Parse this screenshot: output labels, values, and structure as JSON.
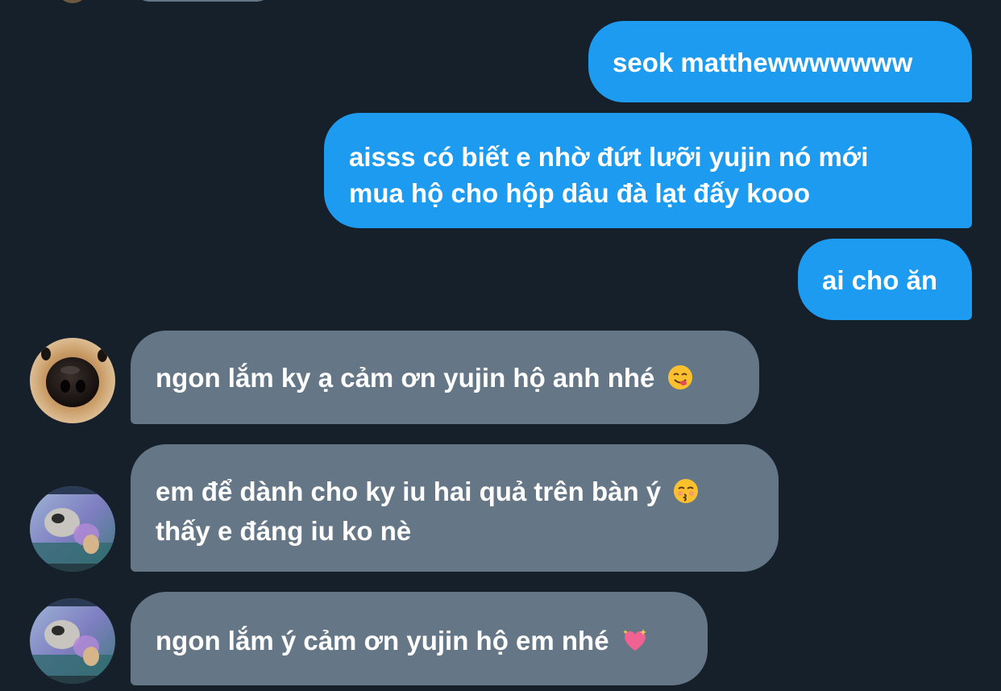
{
  "conversation": {
    "sent": [
      {
        "text": "seok matthewwwwwww"
      },
      {
        "lines": [
          "aisss có biết e nhờ đứt lưỡi yujin nó mới",
          "mua hộ cho hộp dâu đà lạt đấy kooo"
        ]
      },
      {
        "text": "ai cho ăn"
      }
    ],
    "received": [
      {
        "avatar": "dog-nose-avatar",
        "text": "ngon lắm ky ạ cảm ơn yujin hộ anh nhé",
        "emoji": "face-savoring-food-emoji"
      },
      {
        "avatar": "collage-avatar",
        "lines": [
          "em để dành cho ky iu hai quả trên bàn ý",
          "thấy e đáng iu ko nè"
        ],
        "emoji": "kissing-face-emoji"
      },
      {
        "avatar": "collage-avatar",
        "text": "ngon lắm ý cảm ơn yujin hộ em nhé",
        "emoji": "sparkling-heart-emoji"
      }
    ]
  },
  "colors": {
    "background": "#15202b",
    "sent_bubble": "#1d9bf0",
    "received_bubble": "#657786",
    "text": "#ffffff"
  }
}
